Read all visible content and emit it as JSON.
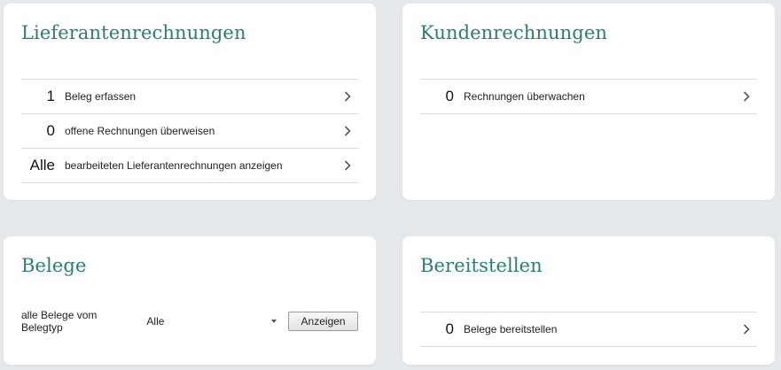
{
  "cards": {
    "lieferantenrechnungen": {
      "title": "Lieferantenrechnungen",
      "rows": [
        {
          "count": "1",
          "label": "Beleg erfassen"
        },
        {
          "count": "0",
          "label": "offene Rechnungen überweisen"
        },
        {
          "count": "Alle",
          "label": "bearbeiteten Lieferantenrechnungen anzeigen"
        }
      ]
    },
    "kundenrechnungen": {
      "title": "Kundenrechnungen",
      "rows": [
        {
          "count": "0",
          "label": "Rechnungen überwachen"
        }
      ]
    },
    "belege": {
      "title": "Belege",
      "filter_label": "alle Belege vom Belegtyp",
      "select_value": "Alle",
      "button_label": "Anzeigen"
    },
    "bereitstellen": {
      "title": "Bereitstellen",
      "rows": [
        {
          "count": "0",
          "label": "Belege bereitstellen"
        }
      ]
    }
  },
  "icons": {
    "row_action": "chevron-right-icon",
    "dropdown": "caret-down-icon"
  },
  "colors": {
    "background": "#e6e9eb",
    "card": "#ffffff",
    "title": "#2a7d74",
    "divider": "#dcdcdc"
  }
}
